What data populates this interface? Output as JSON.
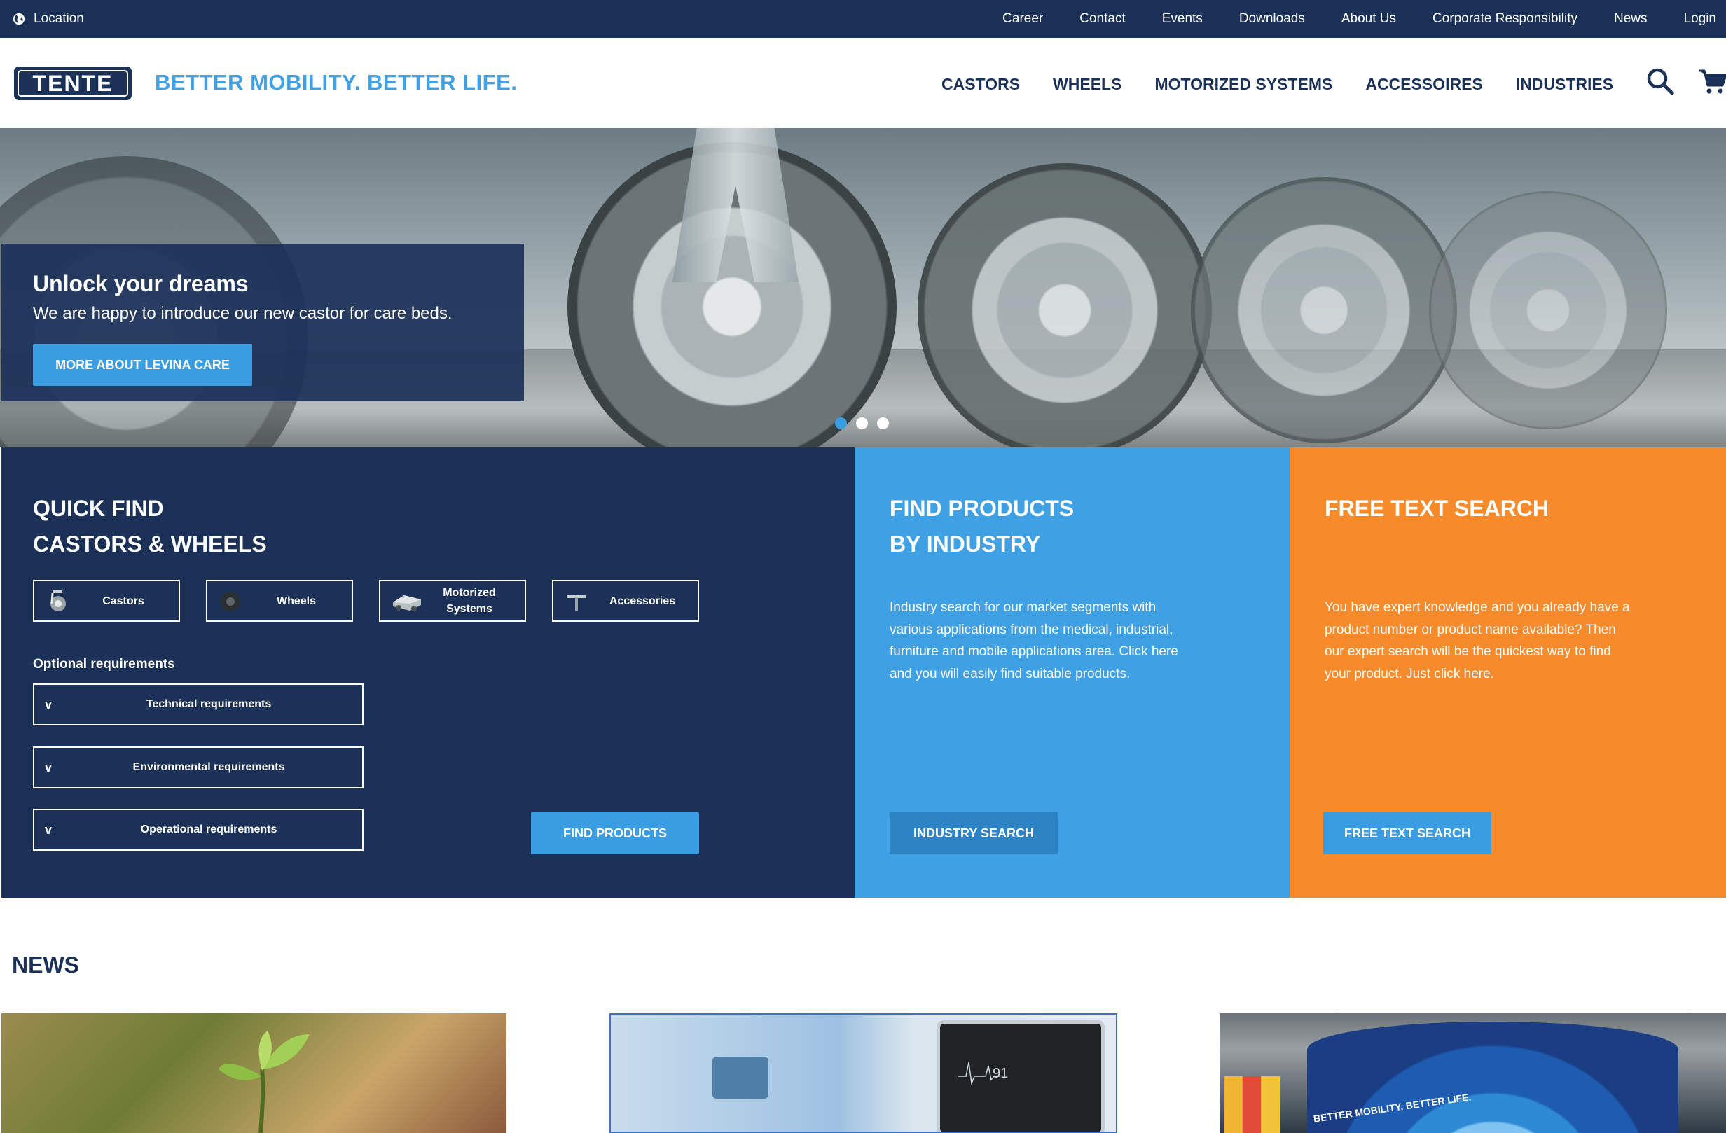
{
  "topbar": {
    "location_label": "Location",
    "links": [
      "Career",
      "Contact",
      "Events",
      "Downloads",
      "About Us",
      "Corporate Responsibility",
      "News",
      "Login"
    ]
  },
  "header": {
    "logo_text": "TENTE",
    "tagline": "BETTER MOBILITY.  BETTER LIFE.",
    "nav": [
      "CASTORS",
      "WHEELS",
      "MOTORIZED SYSTEMS",
      "ACCESSOIRES",
      "INDUSTRIES"
    ]
  },
  "hero": {
    "title": "Unlock your dreams",
    "subtitle": "We are happy to introduce our new castor for care beds.",
    "button": "MORE ABOUT LEVINA CARE",
    "slides_total": 3,
    "active_slide": 1
  },
  "quick_find": {
    "title_line1": "QUICK FIND",
    "title_line2": "CASTORS & WHEELS",
    "categories": [
      {
        "label": "Castors",
        "icon": "castor-icon"
      },
      {
        "label": "Wheels",
        "icon": "wheel-icon"
      },
      {
        "label": "Motorized\nSystems",
        "icon": "motorized-system-icon"
      },
      {
        "label": "Accessories",
        "icon": "accessory-icon"
      }
    ],
    "optional_title": "Optional requirements",
    "requirements": [
      "Technical requirements",
      "Environmental requirements",
      "Operational requirements"
    ],
    "expand_glyph": "v",
    "button": "FIND PRODUCTS"
  },
  "industry": {
    "title_line1": "FIND PRODUCTS",
    "title_line2": "BY INDUSTRY",
    "description": "Industry search for our market segments with various applications from the medical, industrial, furniture and mobile applications area.  Click here and you will easily find suitable products.",
    "button": "INDUSTRY SEARCH"
  },
  "free_text": {
    "title": "FREE TEXT SEARCH",
    "description": "You have expert knowledge and you already have a product number or product name available? Then our expert search will be the quickest way to find your product. Just click here.",
    "button": "FREE TEXT SEARCH"
  },
  "news": {
    "title": "NEWS",
    "monitor_reading": "91",
    "booth_text": "BETTER MOBILITY. BETTER LIFE."
  },
  "colors": {
    "navy": "#1b3158",
    "sky_blue": "#3fa0e3",
    "orange": "#f78b2b",
    "button_blue": "#3a9de2"
  }
}
